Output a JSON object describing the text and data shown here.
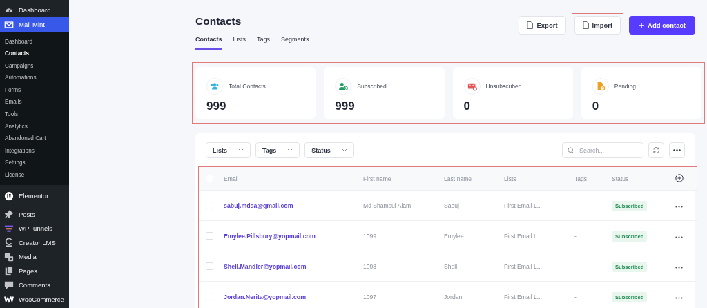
{
  "sidebar": {
    "items": [
      {
        "label": "Dashboard",
        "selected": false
      },
      {
        "label": "Mail Mint",
        "selected": true,
        "children": [
          {
            "label": "Dashboard",
            "selected": false
          },
          {
            "label": "Contacts",
            "selected": true
          },
          {
            "label": "Campaigns",
            "selected": false
          },
          {
            "label": "Automations",
            "selected": false
          },
          {
            "label": "Forms",
            "selected": false
          },
          {
            "label": "Emails",
            "selected": false
          },
          {
            "label": "Tools",
            "selected": false
          },
          {
            "label": "Analytics",
            "selected": false
          },
          {
            "label": "Abandoned Cart",
            "selected": false
          },
          {
            "label": "Integrations",
            "selected": false
          },
          {
            "label": "Settings",
            "selected": false
          },
          {
            "label": "License",
            "selected": false
          }
        ]
      },
      {
        "label": "Elementor",
        "selected": false
      },
      {
        "label": "Posts",
        "selected": false
      },
      {
        "label": "WPFunnels",
        "selected": false
      },
      {
        "label": "Creator LMS",
        "selected": false
      },
      {
        "label": "Media",
        "selected": false
      },
      {
        "label": "Pages",
        "selected": false
      },
      {
        "label": "Comments",
        "selected": false
      },
      {
        "label": "WooCommerce",
        "selected": false
      }
    ]
  },
  "page": {
    "title": "Contacts",
    "tabs": [
      {
        "label": "Contacts",
        "selected": true
      },
      {
        "label": "Lists",
        "selected": false
      },
      {
        "label": "Tags",
        "selected": false
      },
      {
        "label": "Segments",
        "selected": false
      }
    ],
    "actions": [
      {
        "label": "Export",
        "kind": "outline",
        "highlighted": false
      },
      {
        "label": "Import",
        "kind": "outline",
        "highlighted": true
      },
      {
        "label": "Add contact",
        "kind": "primary",
        "highlighted": false
      }
    ]
  },
  "stats": [
    {
      "label": "Total Contacts",
      "value": "999",
      "color": "#2fb4e0"
    },
    {
      "label": "Subscribed",
      "value": "999",
      "color": "#1f9d60"
    },
    {
      "label": "Unsubscribed",
      "value": "0",
      "color": "#e25656"
    },
    {
      "label": "Pending",
      "value": "0",
      "color": "#f0a020"
    }
  ],
  "filters": [
    "Lists",
    "Tags",
    "Status"
  ],
  "search": {
    "placeholder": "Search..."
  },
  "table": {
    "select_all_checked": false,
    "columns": [
      "Email",
      "First name",
      "Last name",
      "Lists",
      "Tags",
      "Status"
    ],
    "rows": [
      {
        "checked": false,
        "email": "sabuj.mdsa@gmail.com",
        "first_name": "Md Shamsul Alam",
        "last_name": "Sabuj",
        "lists": "First Email L...",
        "tags": "-",
        "status": "Subscribed"
      },
      {
        "checked": false,
        "email": "Emylee.Pillsbury@yopmail.com",
        "first_name": "1099",
        "last_name": "Emylee",
        "lists": "First Email L...",
        "tags": "-",
        "status": "Subscribed"
      },
      {
        "checked": false,
        "email": "Shell.Mandler@yopmail.com",
        "first_name": "1098",
        "last_name": "Shell",
        "lists": "First Email L...",
        "tags": "-",
        "status": "Subscribed"
      },
      {
        "checked": false,
        "email": "Jordan.Nerita@yopmail.com",
        "first_name": "1097",
        "last_name": "Jordan",
        "lists": "First Email L...",
        "tags": "-",
        "status": "Subscribed"
      }
    ]
  }
}
